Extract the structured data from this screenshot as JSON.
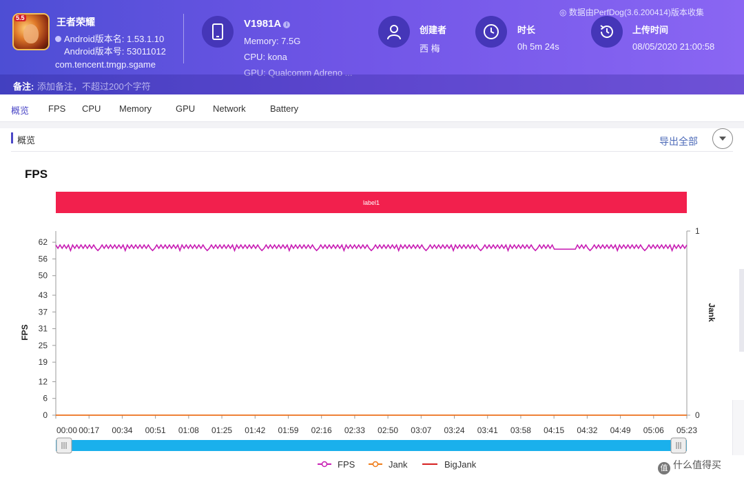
{
  "header": {
    "app_name": "王者荣耀",
    "app_icon_tag": "5.5",
    "android_version_name": "Android版本名: 1.53.1.10",
    "android_version_code": "Android版本号: 53011012",
    "package": "com.tencent.tmgp.sgame",
    "device": {
      "model": "V1981A",
      "info_glyph": "i",
      "memory": "Memory: 7.5G",
      "cpu": "CPU: kona",
      "gpu": "GPU: Qualcomm Adreno ..."
    },
    "creator_label": "创建者",
    "creator_value": "西 梅",
    "duration_label": "时长",
    "duration_value": "0h 5m 24s",
    "upload_label": "上传时间",
    "upload_value": "08/05/2020 21:00:58",
    "version_note": "数据由PerfDog(3.6.200414)版本收集",
    "note_label": "备注:",
    "note_placeholder": "添加备注，不超过200个字符"
  },
  "tabs": [
    {
      "label": "概览",
      "active": true
    },
    {
      "label": "FPS"
    },
    {
      "label": "CPU"
    },
    {
      "label": "Memory"
    },
    {
      "label": "GPU"
    },
    {
      "label": "Network"
    },
    {
      "label": "Battery"
    }
  ],
  "section": {
    "title": "概览",
    "export_label": "导出全部"
  },
  "colors": {
    "header_start": "#4d4ed4",
    "header_end": "#8a66f3",
    "label_band": "#f2204d",
    "fps": "#c81fb4",
    "jank": "#ef7c18",
    "bigjank": "#d61f1f",
    "slider": "#1ab0ec"
  },
  "chart_data": {
    "type": "line",
    "title": "FPS",
    "label_band": "label1",
    "ylabel": "FPS",
    "y2label": "Jank",
    "yticks": [
      0,
      6,
      12,
      19,
      25,
      31,
      37,
      43,
      50,
      56,
      62
    ],
    "ylim": [
      0,
      66
    ],
    "y2ticks": [
      0,
      1
    ],
    "xticks": [
      "00:00",
      "00:17",
      "00:34",
      "00:51",
      "01:08",
      "01:25",
      "01:42",
      "01:59",
      "02:16",
      "02:33",
      "02:50",
      "03:07",
      "03:24",
      "03:41",
      "03:58",
      "04:15",
      "04:32",
      "04:49",
      "05:06",
      "05:23"
    ],
    "x_range_seconds": [
      0,
      323
    ],
    "grid": false,
    "legend_position": "bottom",
    "series": [
      {
        "name": "FPS",
        "summary": "oscillates between about 59 and 61 for the whole session, dipping to about 59 around 04:32"
      },
      {
        "name": "Jank",
        "value": 0
      },
      {
        "name": "BigJank",
        "value": 0
      }
    ]
  },
  "watermark": "什么值得买",
  "watermark_badge": "值"
}
